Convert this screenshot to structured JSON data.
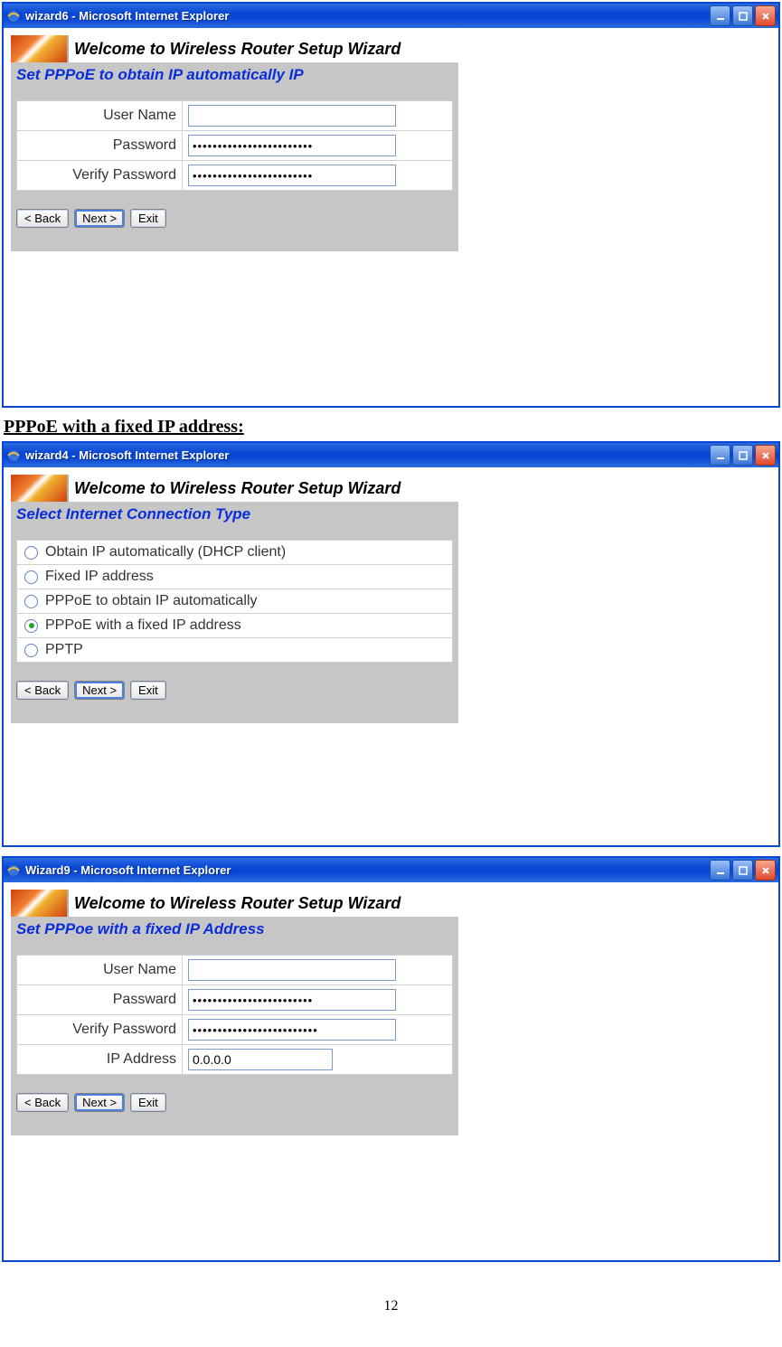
{
  "page_number": "12",
  "section_heading": "PPPoE with a fixed IP address:",
  "windows": [
    {
      "title": "wizard6 - Microsoft Internet Explorer",
      "banner": "Welcome to Wireless Router Setup Wizard",
      "subtitle": "Set PPPoE to obtain IP automatically IP",
      "fields": {
        "username_label": "User Name",
        "username_value": "",
        "password_label": "Password",
        "password_value": "••••••••••••••••••••••••",
        "verify_label": "Verify Password",
        "verify_value": "••••••••••••••••••••••••"
      },
      "buttons": {
        "back": "< Back",
        "next": "Next >",
        "exit": "Exit"
      }
    },
    {
      "title": "wizard4 - Microsoft Internet Explorer",
      "banner": "Welcome to Wireless Router Setup Wizard",
      "subtitle": "Select Internet Connection Type",
      "options": [
        {
          "label": "Obtain IP automatically (DHCP client)",
          "selected": false
        },
        {
          "label": "Fixed IP address",
          "selected": false
        },
        {
          "label": "PPPoE to obtain IP automatically",
          "selected": false
        },
        {
          "label": "PPPoE with a fixed IP address",
          "selected": true
        },
        {
          "label": "PPTP",
          "selected": false
        }
      ],
      "buttons": {
        "back": "< Back",
        "next": "Next >",
        "exit": "Exit"
      }
    },
    {
      "title": "Wizard9 - Microsoft Internet Explorer",
      "banner": "Welcome to Wireless Router Setup Wizard",
      "subtitle": "Set PPPoe with a fixed IP Address",
      "fields": {
        "username_label": "User Name",
        "username_value": "",
        "password_label": "Passward",
        "password_value": "••••••••••••••••••••••••",
        "verify_label": "Verify Password",
        "verify_value": "•••••••••••••••••••••••••",
        "ip_label": "IP Address",
        "ip_value": "0.0.0.0"
      },
      "buttons": {
        "back": "< Back",
        "next": "Next >",
        "exit": "Exit"
      }
    }
  ]
}
